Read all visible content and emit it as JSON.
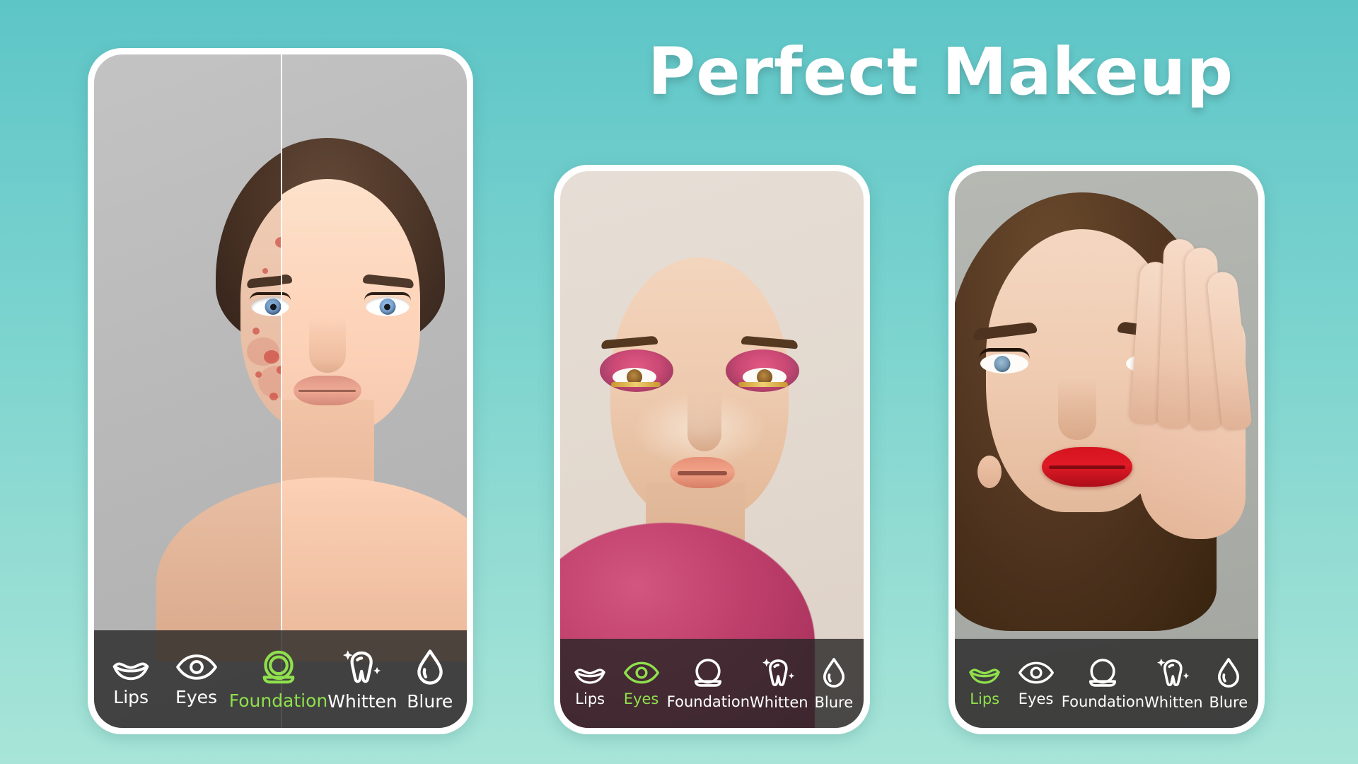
{
  "headline": "Perfect Makeup",
  "theme": {
    "bg_top": "#5EC5C7",
    "bg_bottom": "#A8E5D8",
    "accent_green": "#8FE04C",
    "frame_white": "#FFFFFF",
    "toolbar_overlay": "rgba(38,38,38,0.80)"
  },
  "phones": [
    {
      "id": "phone-1",
      "photo": "before-after-acne-split",
      "toolbar": {
        "items": [
          {
            "label": "Lips",
            "icon": "lips-icon",
            "active": false
          },
          {
            "label": "Eyes",
            "icon": "eye-icon",
            "active": false
          },
          {
            "label": "Foundation",
            "icon": "foundation-icon",
            "active": true
          },
          {
            "label": "Whitten",
            "icon": "tooth-icon",
            "active": false
          },
          {
            "label": "Blure",
            "icon": "droplet-icon",
            "active": false
          }
        ]
      }
    },
    {
      "id": "phone-2",
      "photo": "pink-editorial-eye-makeup",
      "toolbar": {
        "items": [
          {
            "label": "Lips",
            "icon": "lips-icon",
            "active": false
          },
          {
            "label": "Eyes",
            "icon": "eye-icon",
            "active": true
          },
          {
            "label": "Foundation",
            "icon": "foundation-icon",
            "active": false
          },
          {
            "label": "Whitten",
            "icon": "tooth-icon",
            "active": false
          },
          {
            "label": "Blure",
            "icon": "droplet-icon",
            "active": false
          }
        ]
      }
    },
    {
      "id": "phone-3",
      "photo": "red-lipstick-hand-over-eye",
      "toolbar": {
        "items": [
          {
            "label": "Lips",
            "icon": "lips-icon",
            "active": true
          },
          {
            "label": "Eyes",
            "icon": "eye-icon",
            "active": false
          },
          {
            "label": "Foundation",
            "icon": "foundation-icon",
            "active": false
          },
          {
            "label": "Whitten",
            "icon": "tooth-icon",
            "active": false
          },
          {
            "label": "Blure",
            "icon": "droplet-icon",
            "active": false
          }
        ]
      }
    }
  ]
}
